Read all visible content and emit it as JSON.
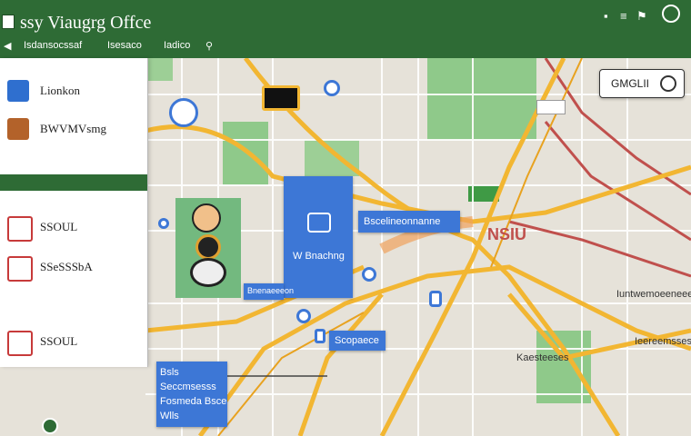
{
  "app": {
    "title": "ssy  Viaugrg Offce"
  },
  "toolbar": {
    "item1": "Isdansocssaf",
    "item2": "Isesaco",
    "item3": "Iadico"
  },
  "sidebar": {
    "items": [
      {
        "label": "Lionkon",
        "color": "#2f6fcf"
      },
      {
        "label": "BWVMVsmg",
        "color": "#b3622a"
      },
      {
        "label": "SSOUL",
        "color": "#c73a3a"
      },
      {
        "label": "SSeSSSbA",
        "color": "#c73a3a"
      },
      {
        "label": "SSOUL",
        "color": "#c73a3a"
      }
    ]
  },
  "map_search": {
    "label": "GMGLII"
  },
  "map": {
    "big_card_label": "W Bnachng",
    "card_top": "Bscelineonnanne",
    "card_small": "Bnenaeeeon",
    "card_mid": "Scopaece",
    "card_bottom": {
      "l1": "Bsls",
      "l2": "Seccmsesss",
      "l3": "Fosmeda Bsce",
      "l4": "Wlls"
    },
    "label_nsu": "NSIU",
    "label_right1": "Iuntwemoeeneeees",
    "label_right2": "Ieereemsses",
    "label_bottom": "Kaesteeses"
  },
  "colors": {
    "brand": "#2e6b35",
    "accent": "#3d77d6",
    "road_major": "#f2b632",
    "road_red": "#c0504d",
    "park": "#8fc98a"
  }
}
